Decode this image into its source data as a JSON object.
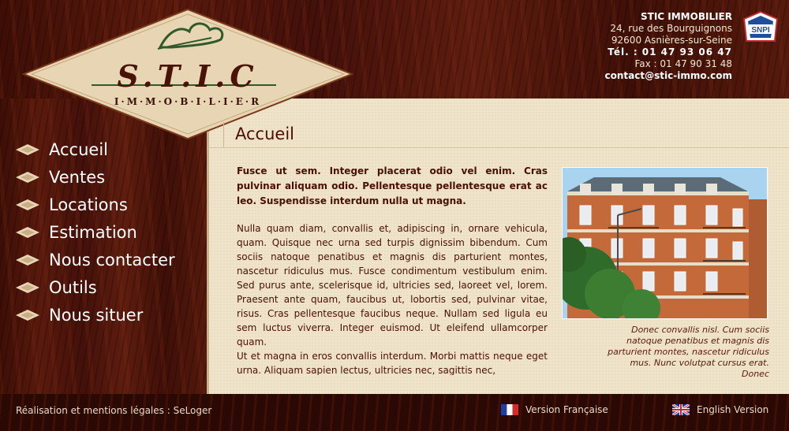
{
  "header": {
    "logo_main": "S.T.I.C",
    "logo_sub": "I·M·M·O·B·I·L·I·E·R",
    "company": "STIC IMMOBILIER",
    "address1": "24, rue des Bourguignons",
    "address2": "92600 Asnières-sur-Seine",
    "phone": "Tél. : 01 47 93 06 47",
    "fax": "Fax : 01 47 90 31 48",
    "email": "contact@stic-immo.com",
    "badge": "SNPI"
  },
  "nav": {
    "items": [
      {
        "label": "Accueil"
      },
      {
        "label": "Ventes"
      },
      {
        "label": "Locations"
      },
      {
        "label": "Estimation"
      },
      {
        "label": "Nous contacter"
      },
      {
        "label": "Outils"
      },
      {
        "label": "Nous situer"
      }
    ]
  },
  "main": {
    "title": "Accueil",
    "lead": "Fusce ut sem. Integer placerat odio vel enim. Cras pulvinar aliquam odio. Pellentesque pellentesque erat ac leo. Suspendisse interdum nulla ut magna.",
    "paragraph1": "Nulla quam diam, convallis et, adipiscing in, ornare vehicula, quam. Quisque nec urna sed turpis dignissim bibendum. Cum sociis natoque penatibus et magnis dis parturient montes, nascetur ridiculus mus. Fusce condimentum vestibulum enim. Sed purus ante, scelerisque id, ultricies sed, laoreet vel, lorem. Praesent ante quam, faucibus ut, lobortis sed, pulvinar vitae, risus. Cras pellentesque faucibus neque. Nullam sed ligula eu sem luctus viverra. Integer euismod. Ut eleifend ullamcorper quam.",
    "paragraph2": "Ut et magna in eros convallis interdum. Morbi mattis neque eget urna. Aliquam sapien lectus, ultricies nec, sagittis nec,",
    "caption": "Donec convallis nisl. Cum sociis natoque penatibus et magnis dis parturient montes, nascetur ridiculus mus. Nunc volutpat cursus erat. Donec"
  },
  "footer": {
    "credit": "Réalisation et mentions légales : SeLoger",
    "lang_fr": "Version Française",
    "lang_en": "English Version"
  },
  "colors": {
    "wood": "#4a1208",
    "content_bg": "#efe3c9",
    "text": "#4a1008",
    "logo_green": "#2f5a2a"
  }
}
